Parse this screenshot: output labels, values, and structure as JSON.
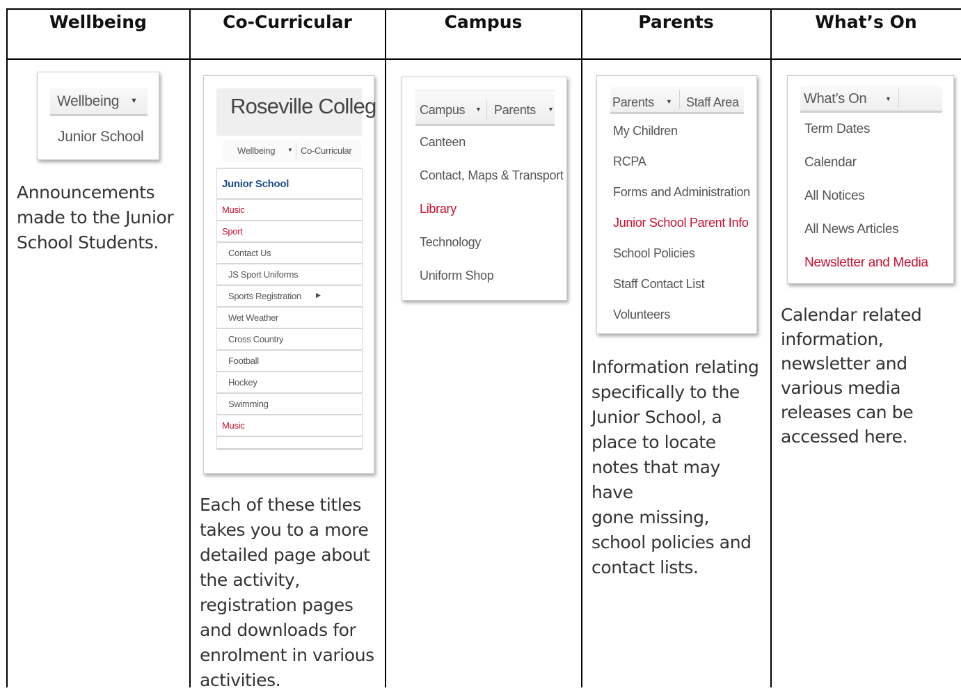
{
  "headers": [
    "Wellbeing",
    "Co-Curricular",
    "Campus",
    "Parents",
    "What’s On"
  ],
  "wellbeing": {
    "nav": "Wellbeing",
    "items": [
      "Junior School"
    ],
    "description_lines": [
      "Announcements",
      "made to the Junior",
      "School Students."
    ]
  },
  "cocurricular": {
    "site_title": "Roseville Colleg",
    "nav": [
      "Wellbeing",
      "Co-Curricular"
    ],
    "items": [
      "Junior School",
      "Music",
      "Sport",
      "Contact Us",
      "JS Sport Uniforms",
      "Sports Registration",
      "Wet Weather",
      "Cross Country",
      "Football",
      "Hockey",
      "Swimming",
      "Music"
    ],
    "description_lines": [
      "Each of these titles",
      "takes you to a more",
      "detailed page about",
      "the activity,",
      "registration pages",
      "and downloads for",
      "enrolment in various",
      "activities."
    ]
  },
  "campus": {
    "nav": [
      "Campus",
      "Parents"
    ],
    "items": [
      "Canteen",
      "Contact, Maps & Transport",
      "Library",
      "Technology",
      "Uniform Shop"
    ]
  },
  "parents": {
    "nav": [
      "Parents",
      "Staff Area"
    ],
    "items": [
      "My Children",
      "RCPA",
      "Forms and Administration",
      "Junior School Parent Info",
      "School Policies",
      "Staff Contact List",
      "Volunteers"
    ],
    "description_lines": [
      "Information relating",
      "specifically to the",
      "Junior School, a",
      "place to locate",
      "notes that may have",
      "gone missing,",
      "school policies and",
      "contact lists."
    ]
  },
  "whatson": {
    "nav": "What’s On",
    "items": [
      "Term Dates",
      "Calendar",
      "All Notices",
      "All News Articles",
      "Newsletter and Media"
    ],
    "description_lines": [
      "Calendar related",
      "information,",
      "newsletter and",
      "various media",
      "releases can be",
      "accessed here."
    ]
  },
  "colors": {
    "highlight_red": "#c8102e",
    "highlight_blue": "#1f4e8c",
    "border": "#000000"
  }
}
